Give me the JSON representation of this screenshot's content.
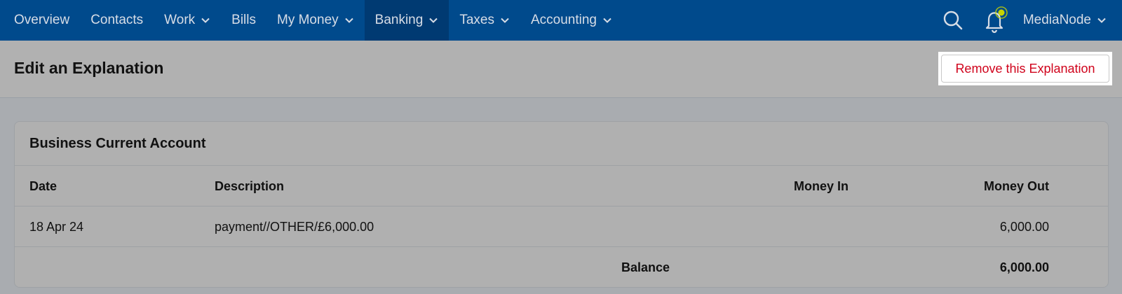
{
  "nav": {
    "items": [
      {
        "label": "Overview",
        "dropdown": false,
        "active": false
      },
      {
        "label": "Contacts",
        "dropdown": false,
        "active": false
      },
      {
        "label": "Work",
        "dropdown": true,
        "active": false
      },
      {
        "label": "Bills",
        "dropdown": false,
        "active": false
      },
      {
        "label": "My Money",
        "dropdown": true,
        "active": false
      },
      {
        "label": "Banking",
        "dropdown": true,
        "active": true
      },
      {
        "label": "Taxes",
        "dropdown": true,
        "active": false
      },
      {
        "label": "Accounting",
        "dropdown": true,
        "active": false
      }
    ],
    "user": "MediaNode",
    "icons": [
      "search-icon",
      "notification-bell-icon",
      "chevron-down-icon"
    ]
  },
  "header": {
    "title": "Edit an Explanation",
    "remove_button": "Remove this Explanation"
  },
  "account": {
    "name": "Business Current Account",
    "columns": {
      "date": "Date",
      "description": "Description",
      "money_in": "Money In",
      "money_out": "Money Out"
    },
    "transaction": {
      "date": "18 Apr 24",
      "description": "payment//OTHER/£6,000.00",
      "money_in": "",
      "money_out": "6,000.00"
    },
    "balance_label": "Balance",
    "balance_value": "6,000.00"
  },
  "colors": {
    "nav_bg": "#004a8c",
    "nav_active": "#003a72",
    "remove_text": "#d0021b",
    "notification_dot": "#c8d400"
  }
}
